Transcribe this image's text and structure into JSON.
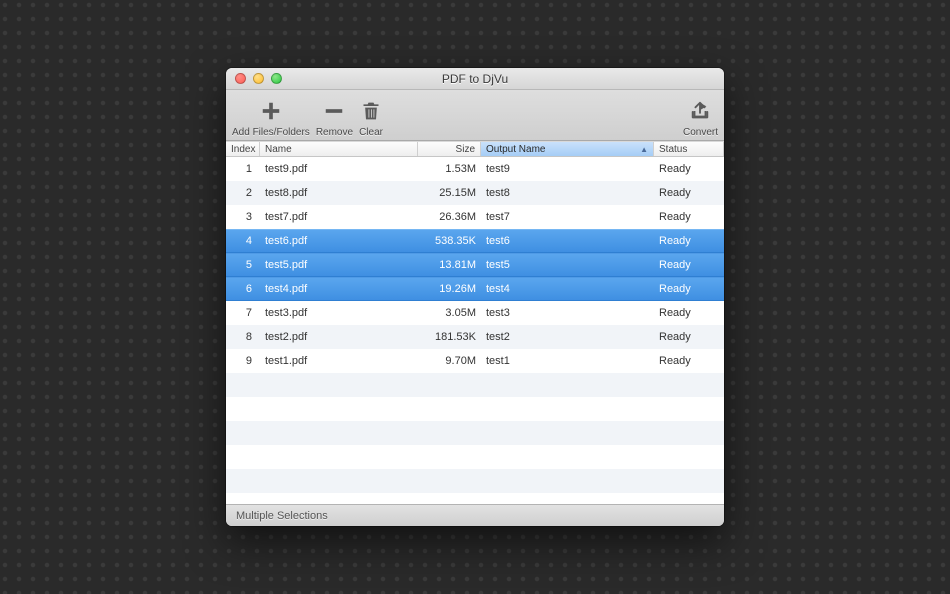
{
  "window": {
    "title": "PDF to DjVu"
  },
  "toolbar": {
    "add_label": "Add Files/Folders",
    "remove_label": "Remove",
    "clear_label": "Clear",
    "convert_label": "Convert"
  },
  "columns": {
    "index": "Index",
    "name": "Name",
    "size": "Size",
    "output": "Output Name",
    "status": "Status"
  },
  "rows": [
    {
      "index": "1",
      "name": "test9.pdf",
      "size": "1.53M",
      "output": "test9",
      "status": "Ready",
      "selected": false
    },
    {
      "index": "2",
      "name": "test8.pdf",
      "size": "25.15M",
      "output": "test8",
      "status": "Ready",
      "selected": false
    },
    {
      "index": "3",
      "name": "test7.pdf",
      "size": "26.36M",
      "output": "test7",
      "status": "Ready",
      "selected": false
    },
    {
      "index": "4",
      "name": "test6.pdf",
      "size": "538.35K",
      "output": "test6",
      "status": "Ready",
      "selected": true
    },
    {
      "index": "5",
      "name": "test5.pdf",
      "size": "13.81M",
      "output": "test5",
      "status": "Ready",
      "selected": true
    },
    {
      "index": "6",
      "name": "test4.pdf",
      "size": "19.26M",
      "output": "test4",
      "status": "Ready",
      "selected": true
    },
    {
      "index": "7",
      "name": "test3.pdf",
      "size": "3.05M",
      "output": "test3",
      "status": "Ready",
      "selected": false
    },
    {
      "index": "8",
      "name": "test2.pdf",
      "size": "181.53K",
      "output": "test2",
      "status": "Ready",
      "selected": false
    },
    {
      "index": "9",
      "name": "test1.pdf",
      "size": "9.70M",
      "output": "test1",
      "status": "Ready",
      "selected": false
    }
  ],
  "status_text": "Multiple Selections",
  "blank_rows": 6
}
